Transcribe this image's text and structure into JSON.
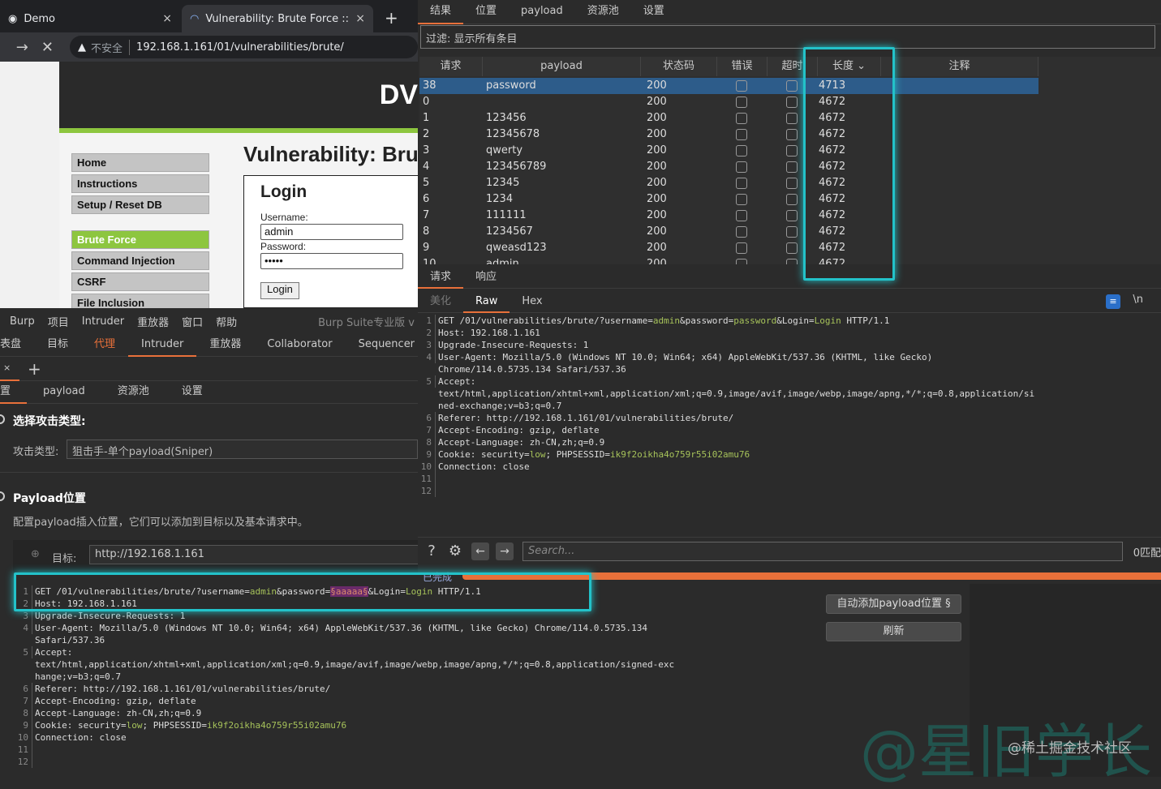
{
  "browser": {
    "tabs": [
      {
        "label": "Demo",
        "close": "×"
      },
      {
        "label": "Vulnerability: Brute Force :: Da",
        "close": "×"
      }
    ],
    "new_tab": "+",
    "nav": {
      "back": "←",
      "forward": "→",
      "stop": "✕"
    },
    "insecure": "不安全",
    "url": "192.168.1.161/01/vulnerabilities/brute/",
    "logo": "DV",
    "menu": [
      "Home",
      "Instructions",
      "Setup / Reset DB",
      "Brute Force",
      "Command Injection",
      "CSRF",
      "File Inclusion"
    ],
    "page_title": "Vulnerability: Brute Force",
    "login": {
      "title": "Login",
      "username_label": "Username:",
      "username": "admin",
      "password_label": "Password:",
      "password": "•••••",
      "button": "Login"
    }
  },
  "burp_left": {
    "menubar": [
      "Burp",
      "项目",
      "Intruder",
      "重放器",
      "窗口",
      "帮助"
    ],
    "version": "Burp Suite专业版 v",
    "main_tabs": [
      "表盘",
      "目标",
      "代理",
      "Intruder",
      "重放器",
      "Collaborator",
      "Sequencer"
    ],
    "tab_close": "×",
    "tab_add": "+",
    "sub_tabs": [
      "置",
      "payload",
      "资源池",
      "设置"
    ],
    "attack_section": "选择攻击类型:",
    "attack_label": "攻击类型:",
    "attack_type": "狙击手-单个payload(Sniper)",
    "positions_section": "Payload位置",
    "positions_desc": "配置payload插入位置，它们可以添加到目标以及基本请求中。",
    "target_label": "目标:",
    "target": "http://192.168.1.161",
    "buttons": {
      "auto_add": "自动添加payload位置 §",
      "refresh": "刷新"
    }
  },
  "results": {
    "tabs": [
      "结果",
      "位置",
      "payload",
      "资源池",
      "设置"
    ],
    "filter": "过滤: 显示所有条目",
    "columns": [
      "请求",
      "payload",
      "状态码",
      "错误",
      "超时",
      "长度 ⌄",
      "注释"
    ],
    "rows": [
      [
        "38",
        "password",
        "200",
        "4713"
      ],
      [
        "0",
        "",
        "200",
        "4672"
      ],
      [
        "1",
        "123456",
        "200",
        "4672"
      ],
      [
        "2",
        "12345678",
        "200",
        "4672"
      ],
      [
        "3",
        "qwerty",
        "200",
        "4672"
      ],
      [
        "4",
        "123456789",
        "200",
        "4672"
      ],
      [
        "5",
        "12345",
        "200",
        "4672"
      ],
      [
        "6",
        "1234",
        "200",
        "4672"
      ],
      [
        "7",
        "111111",
        "200",
        "4672"
      ],
      [
        "8",
        "1234567",
        "200",
        "4672"
      ],
      [
        "9",
        "qweasd123",
        "200",
        "4672"
      ],
      [
        "10",
        "admin",
        "200",
        "4672"
      ]
    ],
    "selected_row": 0,
    "rr_tabs": [
      "请求",
      "响应"
    ],
    "view_tabs": [
      "美化",
      "Raw",
      "Hex"
    ],
    "newline_label": "\\n",
    "search_placeholder": "Search...",
    "matches": "0匹配",
    "progress_label": "已完成",
    "progress": 100
  },
  "response_request": [
    [
      [
        "GET /01/vulnerabilities/brute/?username=",
        ""
      ],
      [
        "admin",
        "g"
      ],
      [
        "&password=",
        ""
      ],
      [
        "password",
        "g"
      ],
      [
        "&Login=",
        ""
      ],
      [
        "Login",
        "g"
      ],
      [
        " HTTP/1.1",
        ""
      ]
    ],
    [
      [
        "Host: 192.168.1.161",
        ""
      ]
    ],
    [
      [
        "Upgrade-Insecure-Requests: 1",
        ""
      ]
    ],
    [
      [
        "User-Agent: Mozilla/5.0 (Windows NT 10.0; Win64; x64) AppleWebKit/537.36 (KHTML, like Gecko)",
        ""
      ]
    ],
    [
      [
        "Chrome/114.0.5735.134 Safari/537.36",
        ""
      ]
    ],
    [
      [
        "Accept:",
        ""
      ]
    ],
    [
      [
        "text/html,application/xhtml+xml,application/xml;q=0.9,image/avif,image/webp,image/apng,*/*;q=0.8,application/si",
        ""
      ]
    ],
    [
      [
        "ned-exchange;v=b3;q=0.7",
        ""
      ]
    ],
    [
      [
        "Referer: http://192.168.1.161/01/vulnerabilities/brute/",
        ""
      ]
    ],
    [
      [
        "Accept-Encoding: gzip, deflate",
        ""
      ]
    ],
    [
      [
        "Accept-Language: zh-CN,zh;q=0.9",
        ""
      ]
    ],
    [
      [
        "Cookie: security=",
        ""
      ],
      [
        "low",
        "g"
      ],
      [
        "; PHPSESSID=",
        ""
      ],
      [
        "ik9f2oikha4o759r55i02amu76",
        "g"
      ]
    ],
    [
      [
        "Connection: close",
        ""
      ]
    ],
    [
      [
        "",
        ""
      ]
    ],
    [
      [
        "",
        ""
      ]
    ]
  ],
  "response_line_numbers": [
    "1",
    "2",
    "3",
    "4",
    "",
    "5",
    "",
    "",
    "6",
    "7",
    "8",
    "9",
    "10",
    "11",
    "12"
  ],
  "base_request": [
    [
      [
        "GET /01/vulnerabilities/brute/?username=",
        ""
      ],
      [
        "admin",
        "g"
      ],
      [
        "&password=",
        ""
      ],
      [
        "§aaaaa§",
        "m"
      ],
      [
        "&Login=",
        ""
      ],
      [
        "Login",
        "g"
      ],
      [
        " HTTP/1.1",
        ""
      ]
    ],
    [
      [
        "Host: 192.168.1.161",
        ""
      ]
    ],
    [
      [
        "Upgrade-Insecure-Requests: 1",
        ""
      ]
    ],
    [
      [
        "User-Agent: Mozilla/5.0 (Windows NT 10.0; Win64; x64) AppleWebKit/537.36 (KHTML, like Gecko) Chrome/114.0.5735.134",
        ""
      ]
    ],
    [
      [
        "Safari/537.36",
        ""
      ]
    ],
    [
      [
        "Accept:",
        ""
      ]
    ],
    [
      [
        "text/html,application/xhtml+xml,application/xml;q=0.9,image/avif,image/webp,image/apng,*/*;q=0.8,application/signed-exc",
        ""
      ]
    ],
    [
      [
        "hange;v=b3;q=0.7",
        ""
      ]
    ],
    [
      [
        "Referer: http://192.168.1.161/01/vulnerabilities/brute/",
        ""
      ]
    ],
    [
      [
        "Accept-Encoding: gzip, deflate",
        ""
      ]
    ],
    [
      [
        "Accept-Language: zh-CN,zh;q=0.9",
        ""
      ]
    ],
    [
      [
        "Cookie: security=",
        ""
      ],
      [
        "low",
        "g"
      ],
      [
        "; PHPSESSID=",
        ""
      ],
      [
        "ik9f2oikha4o759r55i02amu76",
        "g"
      ]
    ],
    [
      [
        "Connection: close",
        ""
      ]
    ],
    [
      [
        "",
        ""
      ]
    ],
    [
      [
        "",
        ""
      ]
    ]
  ],
  "base_line_numbers": [
    "1",
    "2",
    "3",
    "4",
    "",
    "5",
    "",
    "",
    "6",
    "7",
    "8",
    "9",
    "10",
    "11",
    "12"
  ],
  "watermark": {
    "main": "@星旧学长",
    "site": "@稀土掘金技术社区"
  },
  "colors": {
    "accent": "#e8703a",
    "highlight": "#23c2c9",
    "dvwa_green": "#8dc63f",
    "selected_row": "#2d5c8a",
    "value_green": "#a6c25a"
  }
}
